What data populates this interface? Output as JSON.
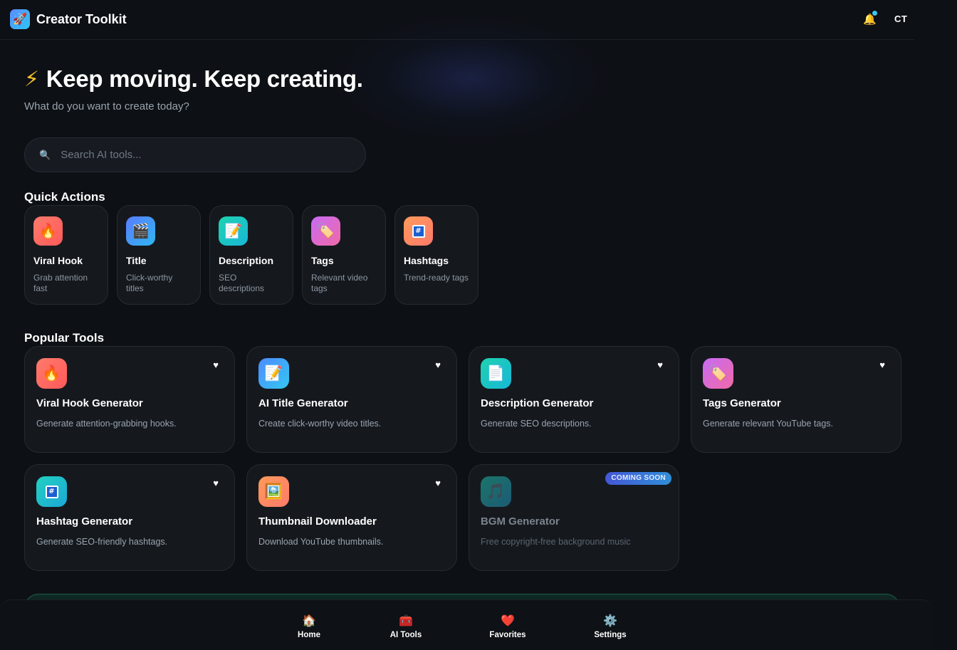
{
  "header": {
    "brand_icon": "🚀",
    "brand_title": "Creator Toolkit",
    "bell_icon": "🔔",
    "avatar_initials": "CT"
  },
  "hero": {
    "bolt_icon": "⚡",
    "title": "Keep moving. Keep creating.",
    "subtitle": "What do you want to create today?"
  },
  "search": {
    "icon": "🔍",
    "placeholder": "Search AI tools..."
  },
  "quick_actions": {
    "title": "Quick Actions",
    "items": [
      {
        "icon": "🔥",
        "title": "Viral Hook",
        "desc": "Grab attention fast"
      },
      {
        "icon": "🎬",
        "title": "Title",
        "desc": "Click-worthy titles"
      },
      {
        "icon": "📝",
        "title": "Description",
        "desc": "SEO descriptions"
      },
      {
        "icon": "🏷️",
        "title": "Tags",
        "desc": "Relevant video tags"
      },
      {
        "icon": "#",
        "title": "Hashtags",
        "desc": "Trend-ready tags"
      }
    ]
  },
  "popular_tools": {
    "title": "Popular Tools",
    "heart": "♥",
    "items": [
      {
        "icon": "🔥",
        "title": "Viral Hook Generator",
        "desc": "Generate attention-grabbing hooks."
      },
      {
        "icon": "📝",
        "title": "AI Title Generator",
        "desc": "Create click-worthy video titles."
      },
      {
        "icon": "📄",
        "title": "Description Generator",
        "desc": "Generate SEO descriptions."
      },
      {
        "icon": "🏷️",
        "title": "Tags Generator",
        "desc": "Generate relevant YouTube tags."
      },
      {
        "icon": "#",
        "title": "Hashtag Generator",
        "desc": "Generate SEO-friendly hashtags."
      },
      {
        "icon": "🖼️",
        "title": "Thumbnail Downloader",
        "desc": "Download YouTube thumbnails."
      },
      {
        "icon": "🎵",
        "title": "BGM Generator",
        "desc": "Free copyright-free background music",
        "badge": "COMING SOON"
      }
    ]
  },
  "bottom_nav": [
    {
      "icon": "🏠",
      "label": "Home"
    },
    {
      "icon": "🧰",
      "label": "AI Tools"
    },
    {
      "icon": "❤️",
      "label": "Favorites"
    },
    {
      "icon": "⚙️",
      "label": "Settings"
    }
  ],
  "colors": {
    "background": "#0d1014",
    "card": "#15191e",
    "accent": "#2fb6f0",
    "bolt": "#f7c12b"
  }
}
